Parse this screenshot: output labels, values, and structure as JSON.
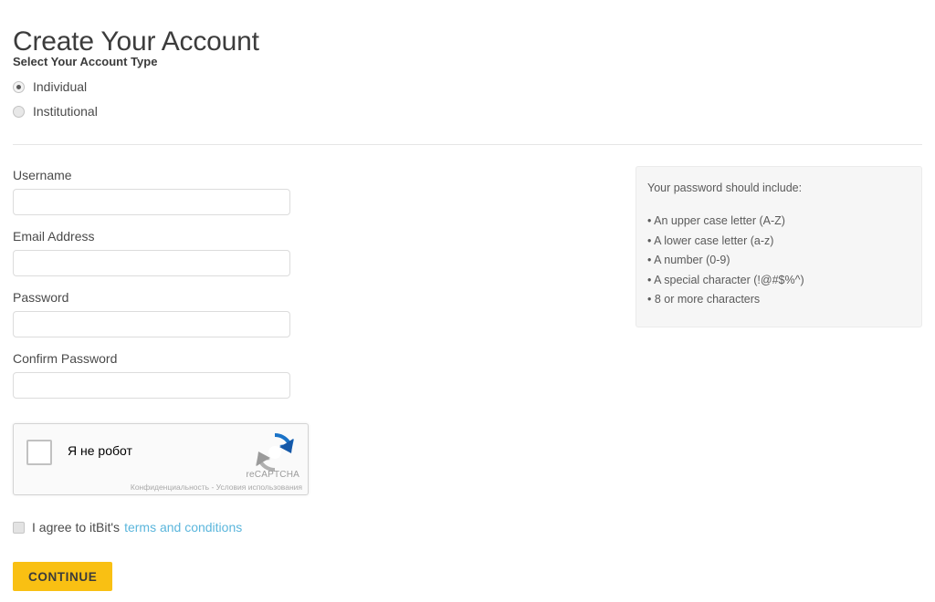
{
  "header": {
    "title": "Create Your Account"
  },
  "account_type": {
    "label": "Select Your Account Type",
    "options": [
      {
        "label": "Individual",
        "selected": true
      },
      {
        "label": "Institutional",
        "selected": false
      }
    ]
  },
  "form": {
    "fields": [
      {
        "label": "Username",
        "value": "",
        "placeholder": ""
      },
      {
        "label": "Email Address",
        "value": "",
        "placeholder": ""
      },
      {
        "label": "Password",
        "value": "",
        "placeholder": ""
      },
      {
        "label": "Confirm Password",
        "value": "",
        "placeholder": ""
      }
    ]
  },
  "password_hints": {
    "title": "Your password should include:",
    "items": [
      "• An upper case letter (A-Z)",
      "• A lower case letter (a-z)",
      "• A number (0-9)",
      "• A special character (!@#$%^)",
      "• 8 or more characters"
    ]
  },
  "recaptcha": {
    "checkbox_label": "Я не робот",
    "brand": "reCAPTCHA",
    "fine_print": "Конфиденциальность - Условия использования",
    "logo_icon": "recaptcha-logo-icon",
    "checked": false
  },
  "terms": {
    "text_before": "I agree to itBit's",
    "link_label": "terms and conditions",
    "checked": false
  },
  "actions": {
    "continue_label": "CONTINUE"
  },
  "colors": {
    "accent_yellow": "#f9c013",
    "link_blue": "#5bb6dc",
    "panel_bg": "#f6f6f6",
    "text_primary": "#4a4a4a"
  }
}
